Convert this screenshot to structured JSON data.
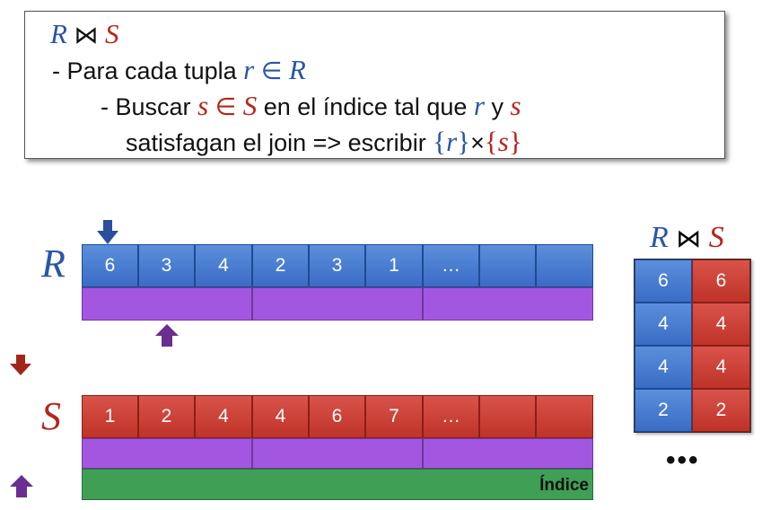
{
  "textbox": {
    "title_r": "R",
    "title_join": "⋈",
    "title_s": "S",
    "line1_dash": "-",
    "line1_text": "Para cada tupla",
    "line1_r": "r",
    "line1_in": "∈",
    "line1_R": "R",
    "line2_dash": "-",
    "line2_buscar": "Buscar",
    "line2_s": "s",
    "line2_in": "∈",
    "line2_S": "S",
    "line2_mid": "en el índice tal que",
    "line2_r": "r",
    "line2_y": "y",
    "line2_s2": "s",
    "line3_text": "satisfagan el join => escribir",
    "line3_lb1": "{",
    "line3_r": "r",
    "line3_rb1": "}",
    "line3_x": "×",
    "line3_lb2": "{",
    "line3_s": "s",
    "line3_rb2": "}"
  },
  "labels": {
    "R": "R",
    "S": "S",
    "index": "Índice"
  },
  "relation_r": [
    "6",
    "3",
    "4",
    "2",
    "3",
    "1",
    "…",
    "",
    ""
  ],
  "relation_s": [
    "1",
    "2",
    "4",
    "4",
    "6",
    "7",
    "…",
    "",
    ""
  ],
  "result": {
    "title_r": "R",
    "title_join": "⋈",
    "title_s": "S",
    "rows": [
      [
        "6",
        "6"
      ],
      [
        "4",
        "4"
      ],
      [
        "4",
        "4"
      ],
      [
        "2",
        "2"
      ]
    ],
    "more": "•••"
  },
  "colors": {
    "blue": "#3a6cc4",
    "red": "#bf3328",
    "purple": "#a357e0",
    "green": "#3fa055",
    "arrow_blue": "#2a4f9e",
    "arrow_red": "#a0261a",
    "arrow_purple": "#6b2d8f"
  }
}
